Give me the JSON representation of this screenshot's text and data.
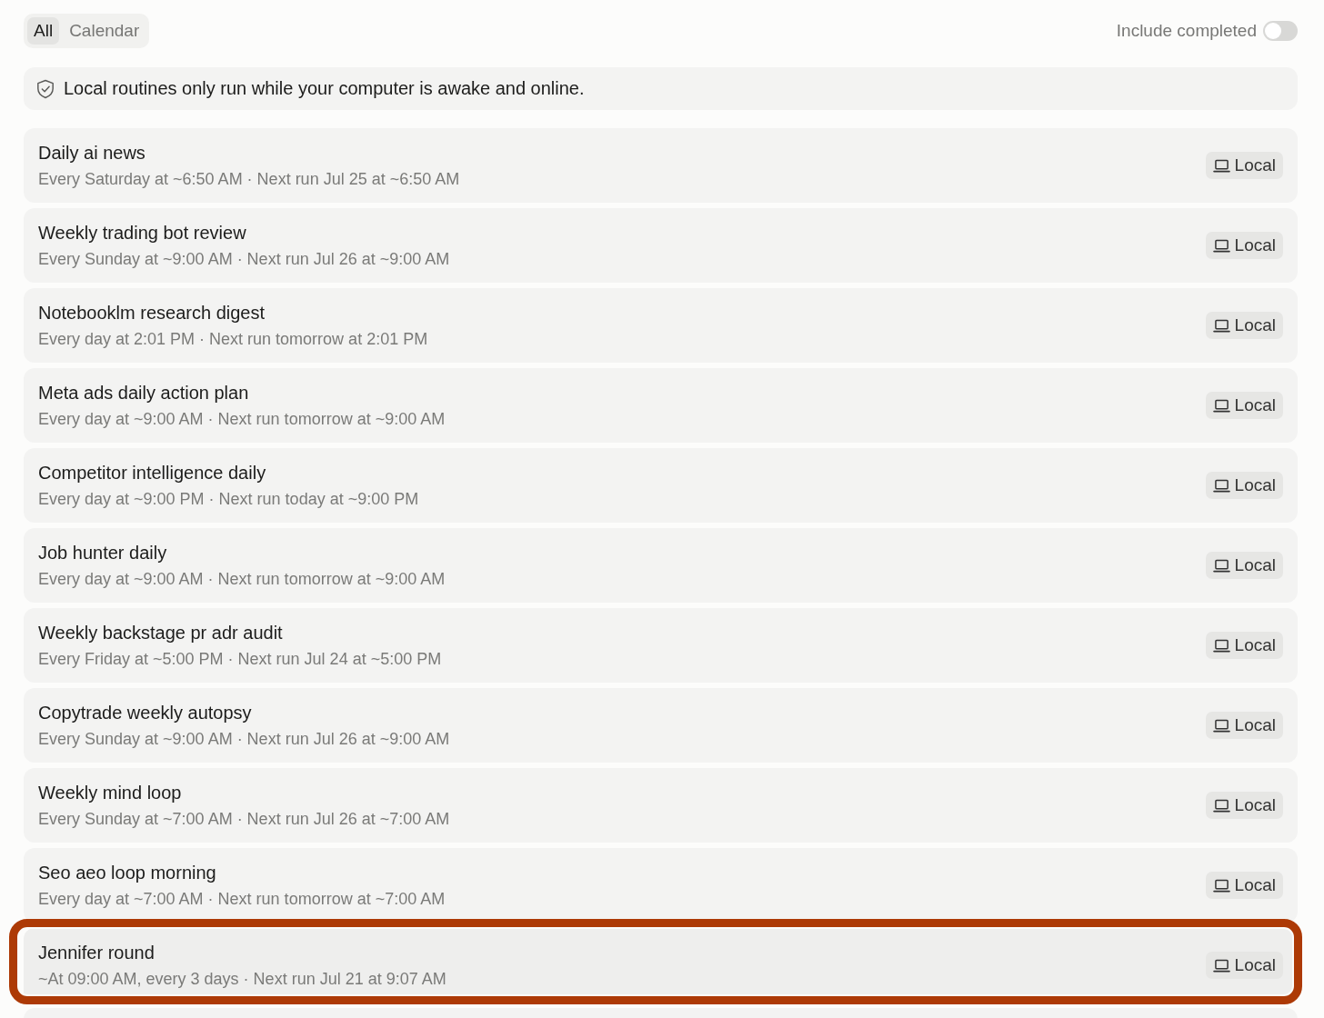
{
  "tabs": [
    {
      "label": "All",
      "selected": true
    },
    {
      "label": "Calendar",
      "selected": false
    }
  ],
  "include_completed": {
    "label": "Include completed",
    "on": false
  },
  "notice": {
    "text": "Local routines only run while your computer is awake and online."
  },
  "routines": [
    {
      "title": "Daily ai news",
      "schedule": "Every Saturday at ~6:50 AM · Next run Jul 25 at ~6:50 AM",
      "badge": "Local",
      "highlighted": false
    },
    {
      "title": "Weekly trading bot review",
      "schedule": "Every Sunday at ~9:00 AM · Next run Jul 26 at ~9:00 AM",
      "badge": "Local",
      "highlighted": false
    },
    {
      "title": "Notebooklm research digest",
      "schedule": "Every day at 2:01 PM · Next run tomorrow at 2:01 PM",
      "badge": "Local",
      "highlighted": false
    },
    {
      "title": "Meta ads daily action plan",
      "schedule": "Every day at ~9:00 AM · Next run tomorrow at ~9:00 AM",
      "badge": "Local",
      "highlighted": false
    },
    {
      "title": "Competitor intelligence daily",
      "schedule": "Every day at ~9:00 PM · Next run today at ~9:00 PM",
      "badge": "Local",
      "highlighted": false
    },
    {
      "title": "Job hunter daily",
      "schedule": "Every day at ~9:00 AM · Next run tomorrow at ~9:00 AM",
      "badge": "Local",
      "highlighted": false
    },
    {
      "title": "Weekly backstage pr adr audit",
      "schedule": "Every Friday at ~5:00 PM · Next run Jul 24 at ~5:00 PM",
      "badge": "Local",
      "highlighted": false
    },
    {
      "title": "Copytrade weekly autopsy",
      "schedule": "Every Sunday at ~9:00 AM · Next run Jul 26 at ~9:00 AM",
      "badge": "Local",
      "highlighted": false
    },
    {
      "title": "Weekly mind loop",
      "schedule": "Every Sunday at ~7:00 AM · Next run Jul 26 at ~7:00 AM",
      "badge": "Local",
      "highlighted": false
    },
    {
      "title": "Seo aeo loop morning",
      "schedule": "Every day at ~7:00 AM · Next run tomorrow at ~7:00 AM",
      "badge": "Local",
      "highlighted": false
    },
    {
      "title": "Jennifer round",
      "schedule": "~At 09:00 AM, every 3 days · Next run Jul 21 at 9:07 AM",
      "badge": "Local",
      "highlighted": true
    }
  ]
}
